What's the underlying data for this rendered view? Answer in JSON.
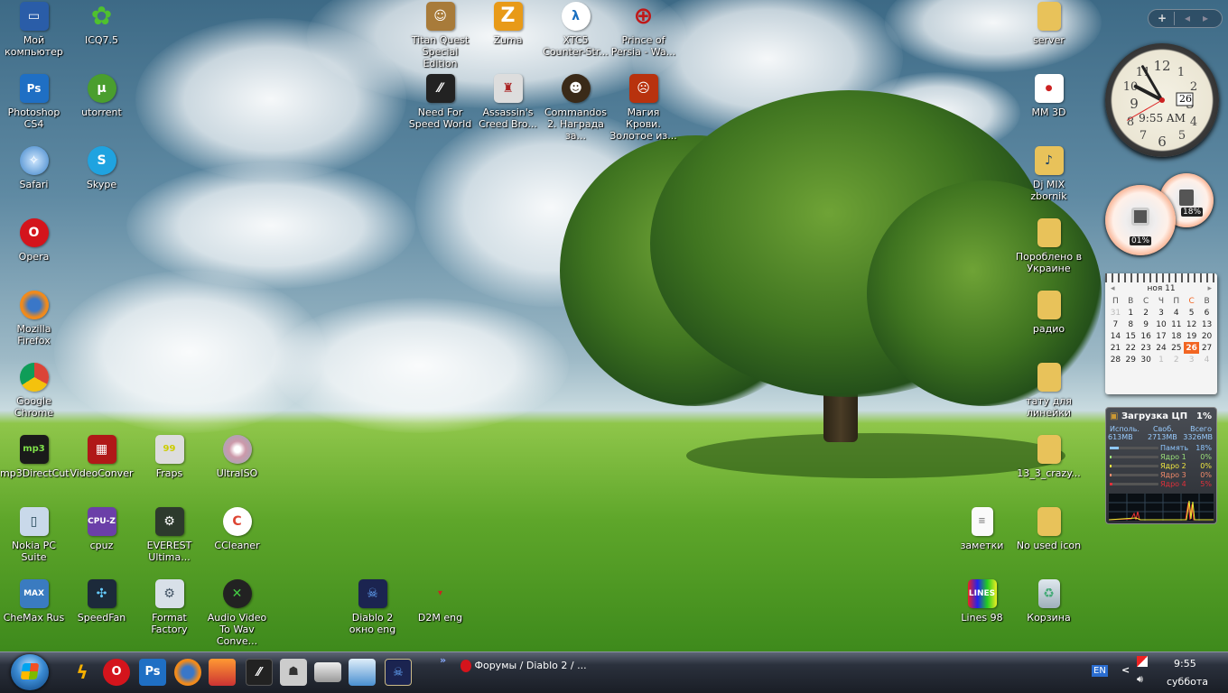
{
  "desktop": {
    "left": [
      {
        "label": "Мой компьютер",
        "icon": "computer-icon"
      },
      {
        "label": "Photoshop CS4",
        "icon": "photoshop-icon"
      },
      {
        "label": "Safari",
        "icon": "safari-icon"
      },
      {
        "label": "Opera",
        "icon": "opera-icon"
      },
      {
        "label": "Mozilla Firefox",
        "icon": "firefox-icon"
      },
      {
        "label": "Google Chrome",
        "icon": "chrome-icon"
      },
      {
        "label": "mp3DirectCut",
        "icon": "mp3directcut-icon"
      },
      {
        "label": "Nokia PC Suite",
        "icon": "nokia-icon"
      },
      {
        "label": "CheMax Rus",
        "icon": "chemax-icon"
      }
    ],
    "col2": [
      {
        "label": "ICQ7.5",
        "icon": "icq-icon"
      },
      {
        "label": "utorrent",
        "icon": "utorrent-icon"
      },
      {
        "label": "Skype",
        "icon": "skype-icon"
      },
      {
        "label": "VideoConver",
        "icon": "video-icon"
      },
      {
        "label": "cpuz",
        "icon": "cpuz-icon"
      },
      {
        "label": "SpeedFan",
        "icon": "fan-icon"
      }
    ],
    "col3": [
      {
        "label": "Fraps",
        "icon": "fraps-icon"
      },
      {
        "label": "EVEREST Ultima...",
        "icon": "everest-icon"
      },
      {
        "label": "Format Factory",
        "icon": "format-factory-icon"
      }
    ],
    "col4": [
      {
        "label": "UltraISO",
        "icon": "disc-icon"
      },
      {
        "label": "CCleaner",
        "icon": "ccleaner-icon"
      },
      {
        "label": "Audio Video To Wav Conve...",
        "icon": "converter-icon"
      }
    ],
    "games": [
      {
        "label": "Titan Quest Special Edition",
        "icon": "titan-quest-icon"
      },
      {
        "label": "Zuma",
        "icon": "zuma-icon"
      },
      {
        "label": "XTC5 Counter-Str...",
        "icon": "counter-strike-icon"
      },
      {
        "label": "Prince of Persia - Wa...",
        "icon": "prince-of-persia-icon"
      },
      {
        "label": "Need For Speed World",
        "icon": "nfs-icon"
      },
      {
        "label": "Assassin's Creed Bro...",
        "icon": "assassins-creed-icon"
      },
      {
        "label": "Commandos 2. Награда за...",
        "icon": "commandos-icon"
      },
      {
        "label": "Магия Крови. Золотое из...",
        "icon": "blood-magic-icon"
      },
      {
        "label": "Diablo 2 окно eng",
        "icon": "diablo-icon"
      },
      {
        "label": "D2M eng",
        "icon": "d2m-icon"
      }
    ],
    "right": [
      {
        "label": "server",
        "icon": "folder-icon"
      },
      {
        "label": "MM 3D",
        "icon": "mm3d-icon"
      },
      {
        "label": "Dj MIX zbornik",
        "icon": "music-folder-icon"
      },
      {
        "label": "Пороблено в Украине",
        "icon": "folder-icon"
      },
      {
        "label": "радио",
        "icon": "folder-icon"
      },
      {
        "label": "тату для линейки",
        "icon": "folder-icon"
      },
      {
        "label": "13_3_crazy...",
        "icon": "folder-icon"
      },
      {
        "label": "No used icon",
        "icon": "folder-icon"
      },
      {
        "label": "Корзина",
        "icon": "recycle-bin-icon"
      },
      {
        "label": "заметки",
        "icon": "text-file-icon"
      },
      {
        "label": "Lines 98",
        "icon": "lines-icon"
      }
    ]
  },
  "gadgets": {
    "bar": {
      "add": "+",
      "prev": "◂",
      "next": "▸"
    },
    "clock": {
      "time": "9:55 AM",
      "date": "26",
      "hour": 9,
      "minute": 55,
      "second": 40
    },
    "gauges": {
      "cpu": "01%",
      "memory": "18%",
      "cpu_value": 1,
      "memory_value": 18
    },
    "calendar": {
      "month": "ноя 11",
      "weekdays": [
        "П",
        "В",
        "С",
        "Ч",
        "П",
        "С",
        "В"
      ],
      "weeks": [
        [
          "31",
          "1",
          "2",
          "3",
          "4",
          "5",
          "6"
        ],
        [
          "7",
          "8",
          "9",
          "10",
          "11",
          "12",
          "13"
        ],
        [
          "14",
          "15",
          "16",
          "17",
          "18",
          "19",
          "20"
        ],
        [
          "21",
          "22",
          "23",
          "24",
          "25",
          "26",
          "27"
        ],
        [
          "28",
          "29",
          "30",
          "1",
          "2",
          "3",
          "4"
        ]
      ],
      "today": "26",
      "accent": "#f26522"
    },
    "cpu": {
      "title": "Загрузка ЦП",
      "total": "1%",
      "h_used": "Исполь.",
      "h_free": "Своб.",
      "h_total": "Всего",
      "used": "613MB",
      "free": "2713MB",
      "all": "3326MB",
      "rows": [
        {
          "label": "Память",
          "value": "18%",
          "color": "#8fc7ff"
        },
        {
          "label": "Ядро 1",
          "value": "0%",
          "color": "#9be07a"
        },
        {
          "label": "Ядро 2",
          "value": "0%",
          "color": "#f0e640"
        },
        {
          "label": "Ядро 3",
          "value": "0%",
          "color": "#f08a6a"
        },
        {
          "label": "Ядро 4",
          "value": "5%",
          "color": "#e0303a"
        }
      ]
    }
  },
  "taskbar": {
    "quicklaunch": [
      "winamp",
      "opera",
      "photoshop",
      "firefox",
      "colosseum",
      "nfs",
      "counter-strike",
      "drive",
      "explorer",
      "diablo"
    ],
    "overflow": "»",
    "task": "Форумы / Diablo 2 / ...",
    "tray": {
      "lang": "EN",
      "chevron": "<",
      "time": "9:55",
      "day": "суббота"
    }
  }
}
